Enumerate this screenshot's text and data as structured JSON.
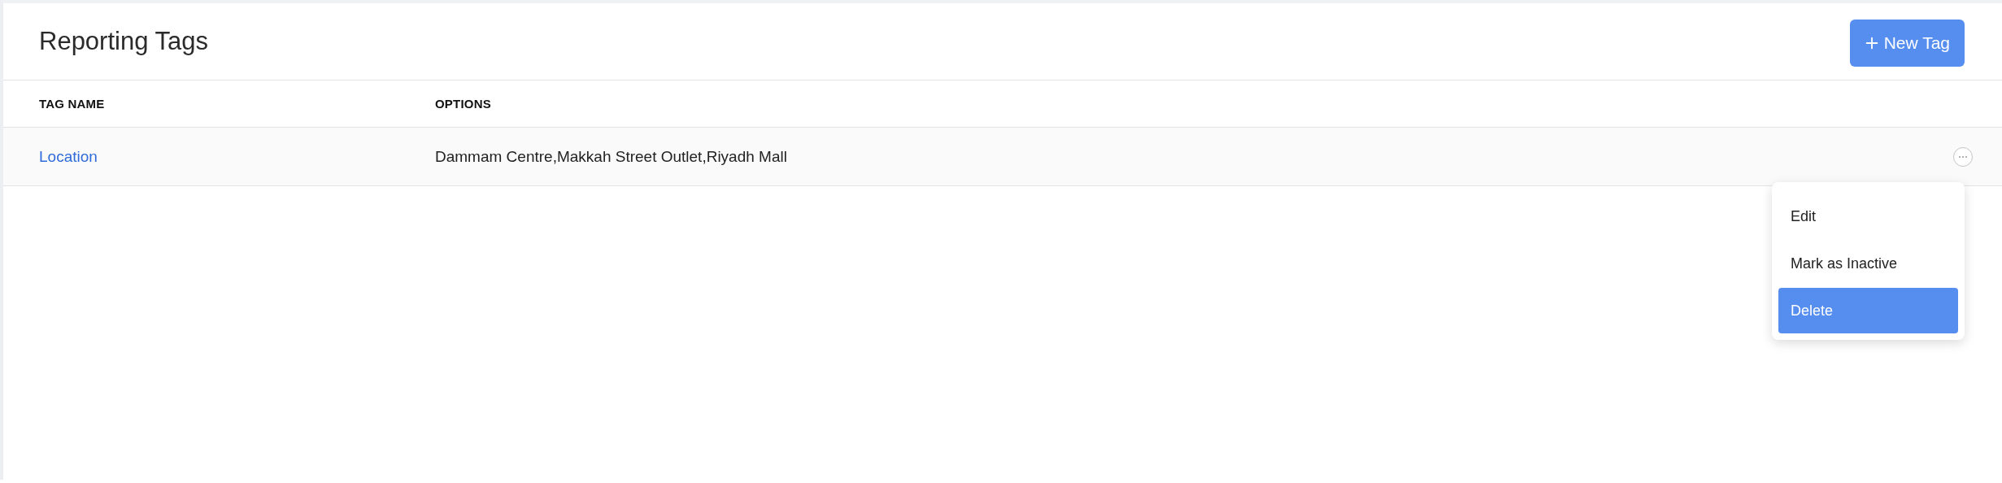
{
  "header": {
    "title": "Reporting Tags",
    "new_button": "New Tag"
  },
  "table": {
    "columns": [
      "TAG NAME",
      "OPTIONS"
    ],
    "rows": [
      {
        "tag_name": "Location",
        "options": "Dammam Centre,Makkah Street Outlet,Riyadh Mall",
        "menu_open": true
      }
    ]
  },
  "row_menu": {
    "items": [
      {
        "label": "Edit",
        "selected": false
      },
      {
        "label": "Mark as Inactive",
        "selected": false
      },
      {
        "label": "Delete",
        "selected": true
      }
    ]
  }
}
